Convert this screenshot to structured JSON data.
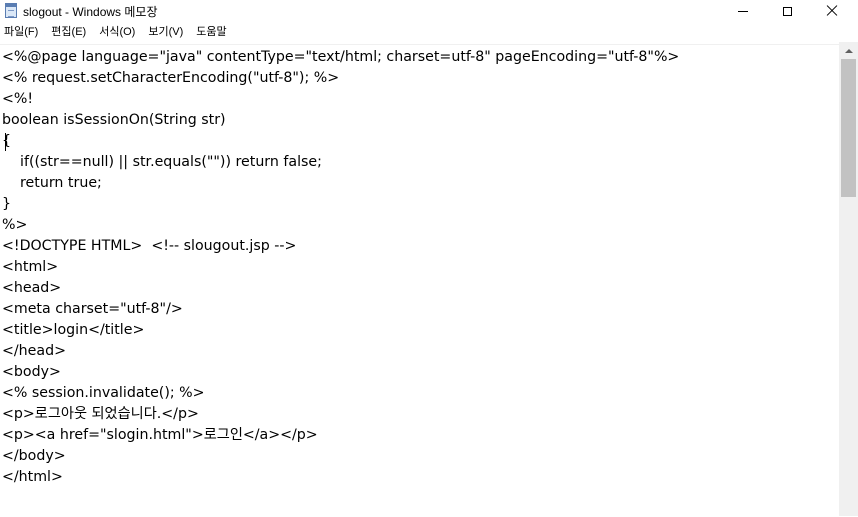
{
  "window": {
    "title": "slogout - Windows 메모장",
    "icon": "notepad-icon",
    "controls": {
      "minimize": "minimize-icon",
      "maximize": "maximize-icon",
      "close": "close-icon"
    }
  },
  "menu": {
    "items": [
      {
        "label": "파일(F)"
      },
      {
        "label": "편집(E)"
      },
      {
        "label": "서식(O)"
      },
      {
        "label": "보기(V)"
      },
      {
        "label": "도움말"
      }
    ]
  },
  "editor": {
    "lines": [
      "<%@page language=\"java\" contentType=\"text/html; charset=utf-8\" pageEncoding=\"utf-8\"%>",
      "<% request.setCharacterEncoding(\"utf-8\"); %>",
      "<%!",
      "boolean isSessionOn(String str)",
      "{",
      "    if((str==null) || str.equals(\"\")) return false;",
      "    return true;",
      "}",
      "%>",
      "<!DOCTYPE HTML>  <!-- slougout.jsp -->",
      "<html>",
      "<head>",
      "<meta charset=\"utf-8\"/>",
      "<title>login</title>",
      "</head>",
      "<body>",
      "<% session.invalidate(); %>",
      "<p>로그아웃 되었습니다.</p>",
      "<p><a href=\"slogin.html\">로그인</a></p>",
      "</body>",
      "</html>"
    ]
  }
}
